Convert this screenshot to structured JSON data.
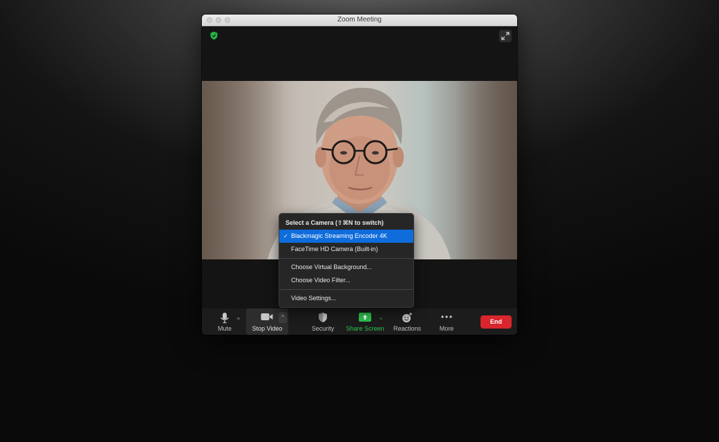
{
  "window": {
    "title": "Zoom Meeting"
  },
  "camera_menu": {
    "header": "Select a Camera (⇧⌘N to switch)",
    "cameras": [
      {
        "label": "Blackmagic Streaming Encoder 4K",
        "selected": true
      },
      {
        "label": "FaceTime HD Camera (Built-in)",
        "selected": false
      }
    ],
    "options": [
      "Choose Virtual Background...",
      "Choose Video Filter..."
    ],
    "settings": "Video Settings..."
  },
  "toolbar": {
    "mute_label": "Mute",
    "stop_video_label": "Stop Video",
    "security_label": "Security",
    "share_screen_label": "Share Screen",
    "reactions_label": "Reactions",
    "more_label": "More",
    "end_label": "End"
  },
  "icons": {
    "encryption": "shield-check-icon",
    "fullscreen": "expand-icon",
    "mute": "microphone-icon",
    "video": "video-camera-icon",
    "security": "shield-icon",
    "share": "share-screen-icon",
    "reactions": "smiley-plus-icon",
    "more": "ellipsis-icon",
    "check": "checkmark-icon"
  },
  "colors": {
    "share_green": "#2dc24c",
    "end_red": "#d8262c",
    "menu_selected": "#0f6cdb",
    "shield_green": "#26b24a"
  }
}
